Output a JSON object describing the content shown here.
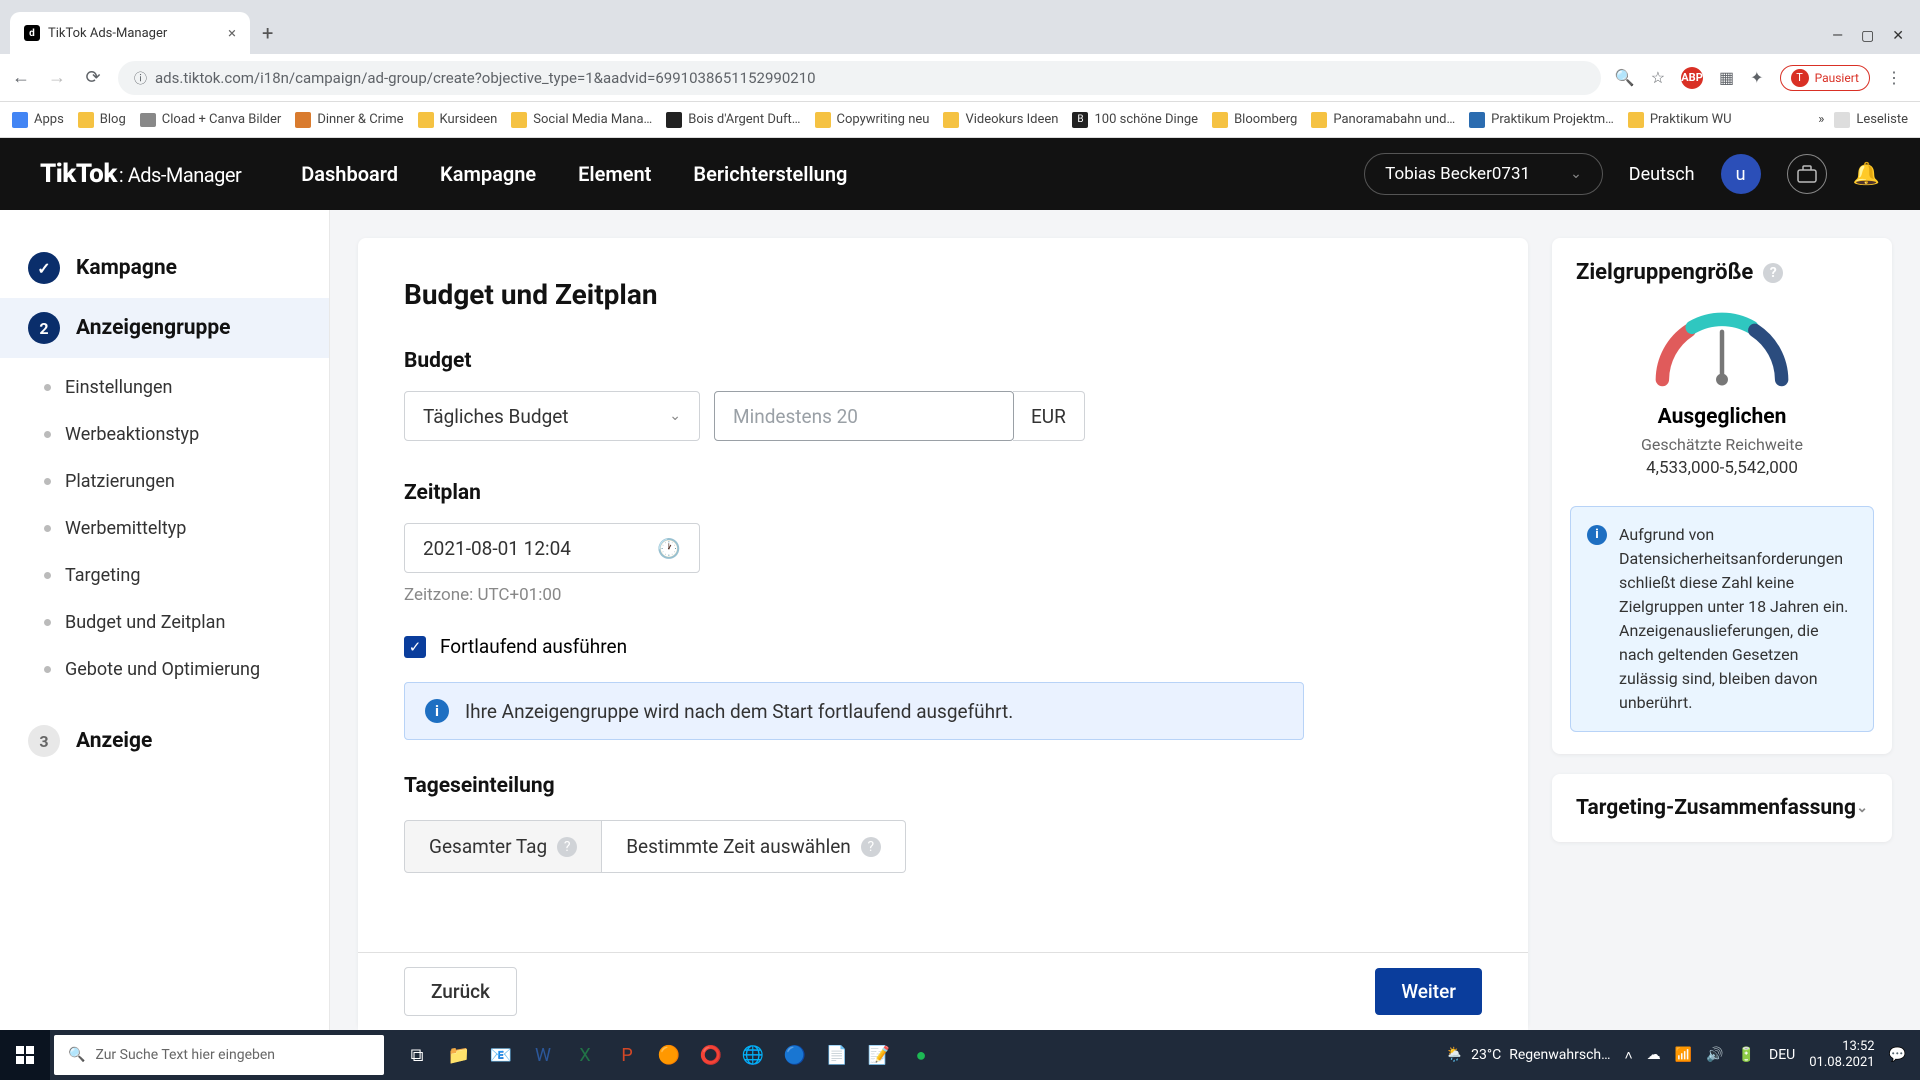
{
  "browser": {
    "tab_title": "TikTok Ads-Manager",
    "url": "ads.tiktok.com/i18n/campaign/ad-group/create?objective_type=1&aadvid=6991038651152990210",
    "pause_label": "Pausiert",
    "bookmarks": [
      "Apps",
      "Blog",
      "Cload + Canva Bilder",
      "Dinner & Crime",
      "Kursideen",
      "Social Media Mana…",
      "Bois d'Argent Duft…",
      "Copywriting neu",
      "Videokurs Ideen",
      "100 schöne Dinge",
      "Bloomberg",
      "Panoramabahn und…",
      "Praktikum Projektm…",
      "Praktikum WU"
    ],
    "reading_list": "Leseliste"
  },
  "header": {
    "logo": "TikTok",
    "logo_sub": ": Ads-Manager",
    "nav": [
      "Dashboard",
      "Kampagne",
      "Element",
      "Berichterstellung"
    ],
    "account": "Tobias Becker0731",
    "language": "Deutsch",
    "avatar_letter": "u"
  },
  "sidebar": {
    "steps": [
      {
        "num": "",
        "label": "Kampagne",
        "state": "done"
      },
      {
        "num": "2",
        "label": "Anzeigengruppe",
        "state": "current"
      },
      {
        "num": "3",
        "label": "Anzeige",
        "state": "future"
      }
    ],
    "substeps": [
      "Einstellungen",
      "Werbeaktionstyp",
      "Platzierungen",
      "Werbemitteltyp",
      "Targeting",
      "Budget und Zeitplan",
      "Gebote und Optimierung"
    ]
  },
  "form": {
    "title": "Budget und Zeitplan",
    "budget_label": "Budget",
    "budget_type": "Tägliches Budget",
    "budget_placeholder": "Mindestens 20",
    "currency": "EUR",
    "schedule_label": "Zeitplan",
    "schedule_value": "2021-08-01 12:04",
    "timezone": "Zeitzone: UTC+01:00",
    "continuous_label": "Fortlaufend ausführen",
    "continuous_info": "Ihre Anzeigengruppe wird nach dem Start fortlaufend ausgeführt.",
    "dayparting_label": "Tageseinteilung",
    "dayparting_options": [
      "Gesamter Tag",
      "Bestimmte Zeit auswählen"
    ],
    "back": "Zurück",
    "next": "Weiter"
  },
  "audience": {
    "title": "Zielgruppengröße",
    "verdict": "Ausgeglichen",
    "reach_label": "Geschätzte Reichweite",
    "reach_range": "4,533,000-5,542,000",
    "notice": "Aufgrund von Datensicherheitsanforderungen schließt diese Zahl keine Zielgruppen unter 18 Jahren ein. Anzeigenauslieferungen, die nach geltenden Gesetzen zulässig sind, bleiben davon unberührt.",
    "summary_title": "Targeting-Zusammenfassung"
  },
  "taskbar": {
    "search_placeholder": "Zur Suche Text hier eingeben",
    "weather_temp": "23°C",
    "weather_text": "Regenwahrsch…",
    "lang": "DEU",
    "time": "13:52",
    "date": "01.08.2021"
  }
}
